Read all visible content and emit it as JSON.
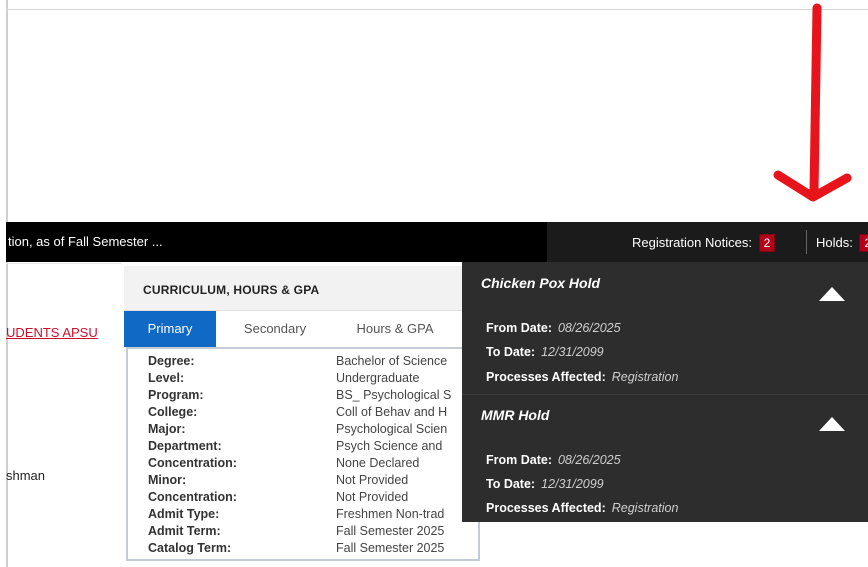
{
  "statusbar": {
    "text": "tion, as of Fall Semester ...",
    "registration_label": "Registration Notices:",
    "registration_count": "2",
    "holds_label": "Holds:",
    "holds_count": "2"
  },
  "left": {
    "link_text": "UDENTS APSU",
    "classification": "shman"
  },
  "curriculum": {
    "title": "CURRICULUM, HOURS & GPA",
    "tabs": [
      {
        "label": "Primary",
        "active": true
      },
      {
        "label": "Secondary",
        "active": false
      },
      {
        "label": "Hours & GPA",
        "active": false
      }
    ],
    "rows": [
      {
        "label": "Degree:",
        "value": "Bachelor of Science"
      },
      {
        "label": "Level:",
        "value": "Undergraduate"
      },
      {
        "label": "Program:",
        "value": "BS_ Psychological S"
      },
      {
        "label": "College:",
        "value": "Coll of Behav and H"
      },
      {
        "label": "Major:",
        "value": "Psychological Scien"
      },
      {
        "label": "Department:",
        "value": "Psych Science and"
      },
      {
        "label": "Concentration:",
        "value": "None Declared"
      },
      {
        "label": "Minor:",
        "value": "Not Provided"
      },
      {
        "label": "Concentration:",
        "value": "Not Provided"
      },
      {
        "label": "Admit Type:",
        "value": "Freshmen Non-trad"
      },
      {
        "label": "Admit Term:",
        "value": "Fall Semester 2025"
      },
      {
        "label": "Catalog Term:",
        "value": "Fall Semester 2025"
      }
    ]
  },
  "holds": [
    {
      "title": "Chicken Pox Hold",
      "from_label": "From Date:",
      "from_value": "08/26/2025",
      "to_label": "To Date:",
      "to_value": "12/31/2099",
      "processes_label": "Processes Affected:",
      "processes_value": "Registration"
    },
    {
      "title": "MMR Hold",
      "from_label": "From Date:",
      "from_value": "08/26/2025",
      "to_label": "To Date:",
      "to_value": "12/31/2099",
      "processes_label": "Processes Affected:",
      "processes_value": "Registration"
    }
  ],
  "colors": {
    "annotation_arrow": "#e8141b",
    "badge": "#b3001b",
    "active_tab": "#1169c6",
    "holds_background": "#2d2d2d"
  }
}
